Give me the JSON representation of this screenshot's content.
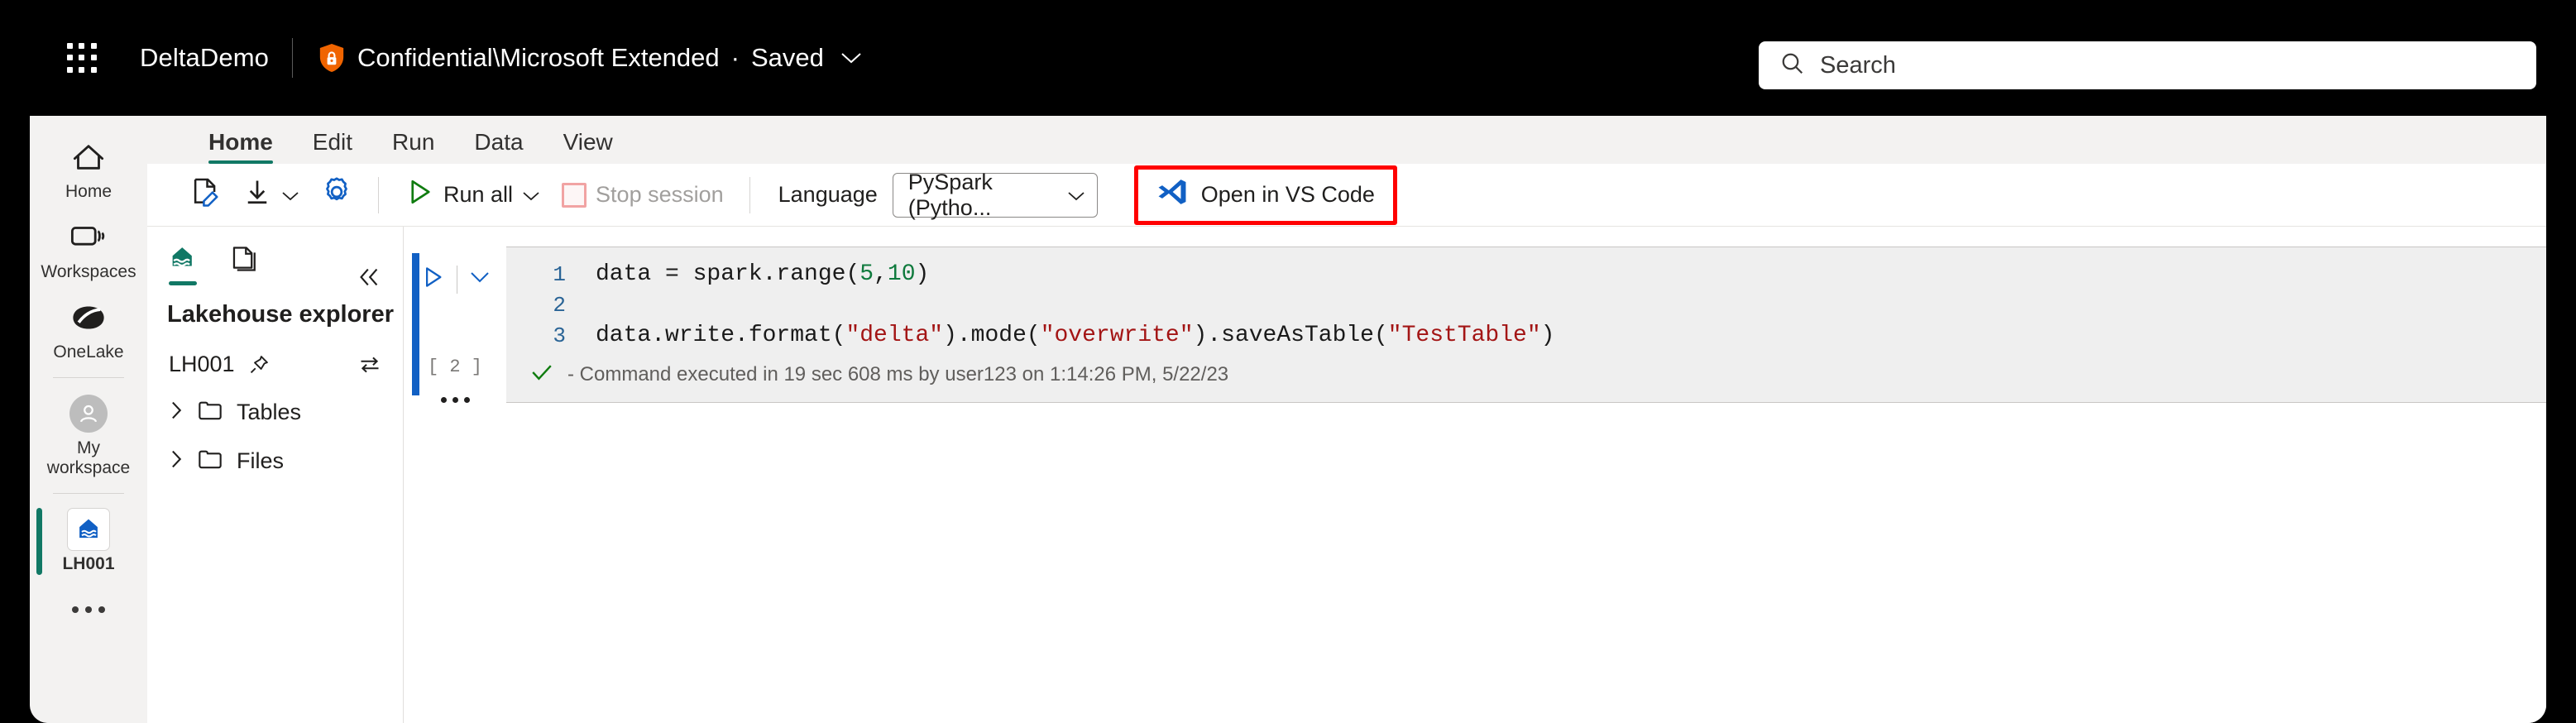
{
  "header": {
    "waffle_icon": "app-launcher-icon",
    "app_title": "DeltaDemo",
    "sensitivity_icon": "shield-lock-icon",
    "sensitivity_label": "Confidential\\Microsoft Extended",
    "separator_dot": "·",
    "save_state": "Saved",
    "save_chevron_icon": "chevron-down-icon"
  },
  "search": {
    "icon": "search-icon",
    "placeholder": "Search",
    "value": ""
  },
  "sidebar": {
    "items": [
      {
        "label": "Home",
        "icon": "home-icon",
        "active": false
      },
      {
        "label": "Workspaces",
        "icon": "workspaces-icon",
        "active": false
      },
      {
        "label": "OneLake",
        "icon": "onelake-icon",
        "active": false
      },
      {
        "label": "My workspace",
        "icon": "person-avatar-icon",
        "active": false
      },
      {
        "label": "LH001",
        "icon": "lakehouse-icon",
        "active": true
      }
    ],
    "more_icon": "more-horizontal-icon"
  },
  "ribbon": {
    "tabs": [
      {
        "label": "Home",
        "active": true
      },
      {
        "label": "Edit",
        "active": false
      },
      {
        "label": "Run",
        "active": false
      },
      {
        "label": "Data",
        "active": false
      },
      {
        "label": "View",
        "active": false
      }
    ]
  },
  "toolbar": {
    "edit_mode_icon": "edit-document-icon",
    "download_icon": "download-icon",
    "download_chevron_icon": "chevron-down-icon",
    "settings_icon": "gear-icon",
    "run_all_icon": "play-triangle-icon",
    "run_all_label": "Run all",
    "run_all_chevron_icon": "chevron-down-icon",
    "stop_session_icon": "stop-square-icon",
    "stop_session_label": "Stop session",
    "stop_session_disabled": true,
    "language_label": "Language",
    "language_value": "PySpark (Pytho...",
    "language_chevron_icon": "chevron-down-icon",
    "vscode_icon": "vscode-logo-icon",
    "vscode_label": "Open in VS Code",
    "highlight_color": "#ff0000"
  },
  "explorer": {
    "tab_lakehouse_icon": "lakehouse-icon",
    "tab_notebook_icon": "document-copy-icon",
    "collapse_icon": "chevron-double-left-icon",
    "title": "Lakehouse explorer",
    "lakehouse_name": "LH001",
    "pin_icon": "pin-icon",
    "swap_icon": "swap-arrows-icon",
    "tree": [
      {
        "label": "Tables",
        "expand_icon": "chevron-right-icon",
        "folder_icon": "folder-icon"
      },
      {
        "label": "Files",
        "expand_icon": "chevron-right-icon",
        "folder_icon": "folder-icon"
      }
    ]
  },
  "notebook": {
    "cell": {
      "run_icon": "play-triangle-icon",
      "collapse_icon": "chevron-down-icon",
      "execution_count": "[ 2 ]",
      "more_icon": "more-horizontal-icon",
      "lines": [
        {
          "number": "1",
          "tokens": [
            {
              "text": "data = spark.range(",
              "type": "plain"
            },
            {
              "text": "5",
              "type": "num"
            },
            {
              "text": ",",
              "type": "plain"
            },
            {
              "text": "10",
              "type": "num"
            },
            {
              "text": ")",
              "type": "plain"
            }
          ]
        },
        {
          "number": "2",
          "tokens": []
        },
        {
          "number": "3",
          "tokens": [
            {
              "text": "data.write.format(",
              "type": "plain"
            },
            {
              "text": "\"delta\"",
              "type": "str"
            },
            {
              "text": ").mode(",
              "type": "plain"
            },
            {
              "text": "\"overwrite\"",
              "type": "str"
            },
            {
              "text": ").saveAsTable(",
              "type": "plain"
            },
            {
              "text": "\"TestTable\"",
              "type": "str"
            },
            {
              "text": ")",
              "type": "plain"
            }
          ]
        }
      ],
      "status_icon": "checkmark-icon",
      "status_text": "- Command executed in 19 sec 608 ms by user123 on 1:14:26 PM, 5/22/23"
    }
  },
  "colors": {
    "brand_green": "#117865",
    "accent_blue": "#1160c4",
    "success_green": "#107c10",
    "string_red": "#a31515",
    "number_green": "#0f7a3d",
    "sensitivity_orange": "#f06400"
  }
}
